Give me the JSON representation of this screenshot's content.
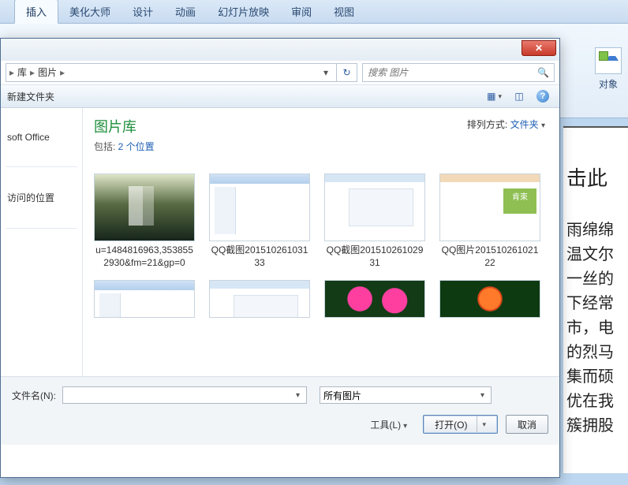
{
  "ribbon": {
    "tabs": [
      "插入",
      "美化大师",
      "设计",
      "动画",
      "幻灯片放映",
      "审阅",
      "视图"
    ],
    "active_index": 0,
    "object_label": "对象"
  },
  "dialog": {
    "breadcrumb": {
      "seg1": "库",
      "seg2": "图片"
    },
    "search_placeholder": "搜索 图片",
    "toolbar": {
      "new_folder": "新建文件夹"
    },
    "sidebar": {
      "item_office": "soft Office",
      "item_recent": "访问的位置"
    },
    "library": {
      "title": "图片库",
      "subtitle_prefix": "包括: ",
      "subtitle_link": "2 个位置",
      "sort_label": "排列方式:",
      "sort_value": "文件夹"
    },
    "thumbs_row1": [
      {
        "name": "u=1484816963,3538552930&fm=21&gp=0",
        "kind": "forest"
      },
      {
        "name": "QQ截图20151026103133",
        "kind": "ppt-a"
      },
      {
        "name": "QQ截图20151026102931",
        "kind": "ppt-b"
      },
      {
        "name": "QQ图片20151026102122",
        "kind": "ppt-c"
      }
    ],
    "thumbs_row2": [
      {
        "kind": "ppt-a"
      },
      {
        "kind": "ppt-b"
      },
      {
        "kind": "rose-p"
      },
      {
        "kind": "rose-o"
      }
    ],
    "bottom": {
      "filename_label": "文件名(N):",
      "filter_value": "所有图片",
      "tools_label": "工具(L)",
      "open_label": "打开(O)",
      "cancel_label": "取消"
    }
  },
  "document": {
    "text": "雨绵绵温文尔一丝的下经常市，电的烈马集而硕优在我簇拥股"
  }
}
